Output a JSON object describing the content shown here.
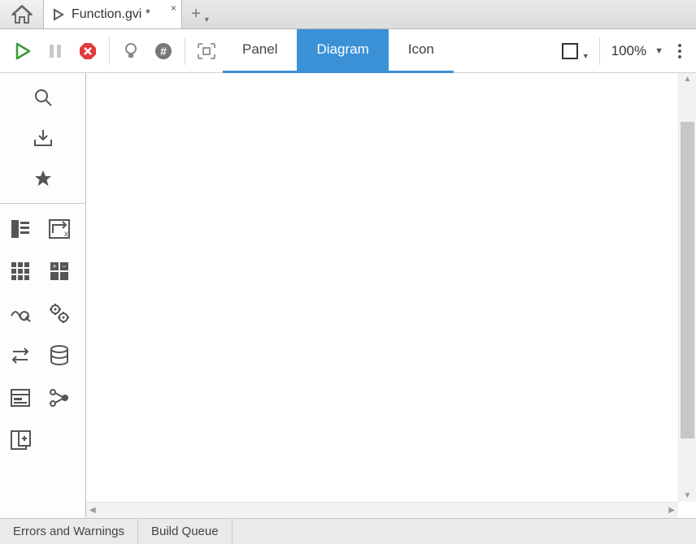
{
  "tabs": {
    "file_name": "Function.gvi *"
  },
  "toolbar": {
    "views": {
      "panel": "Panel",
      "diagram": "Diagram",
      "icon": "Icon"
    },
    "zoom": "100%"
  },
  "status": {
    "errors": "Errors and Warnings",
    "queue": "Build Queue"
  },
  "icons": {
    "home": "home-icon",
    "run": "run-icon",
    "pause": "pause-icon",
    "stop": "stop-icon",
    "bulb": "bulb-icon",
    "hash": "hash-icon",
    "scan": "scan-icon",
    "search": "search-icon",
    "download": "download-icon",
    "star": "star-icon"
  }
}
